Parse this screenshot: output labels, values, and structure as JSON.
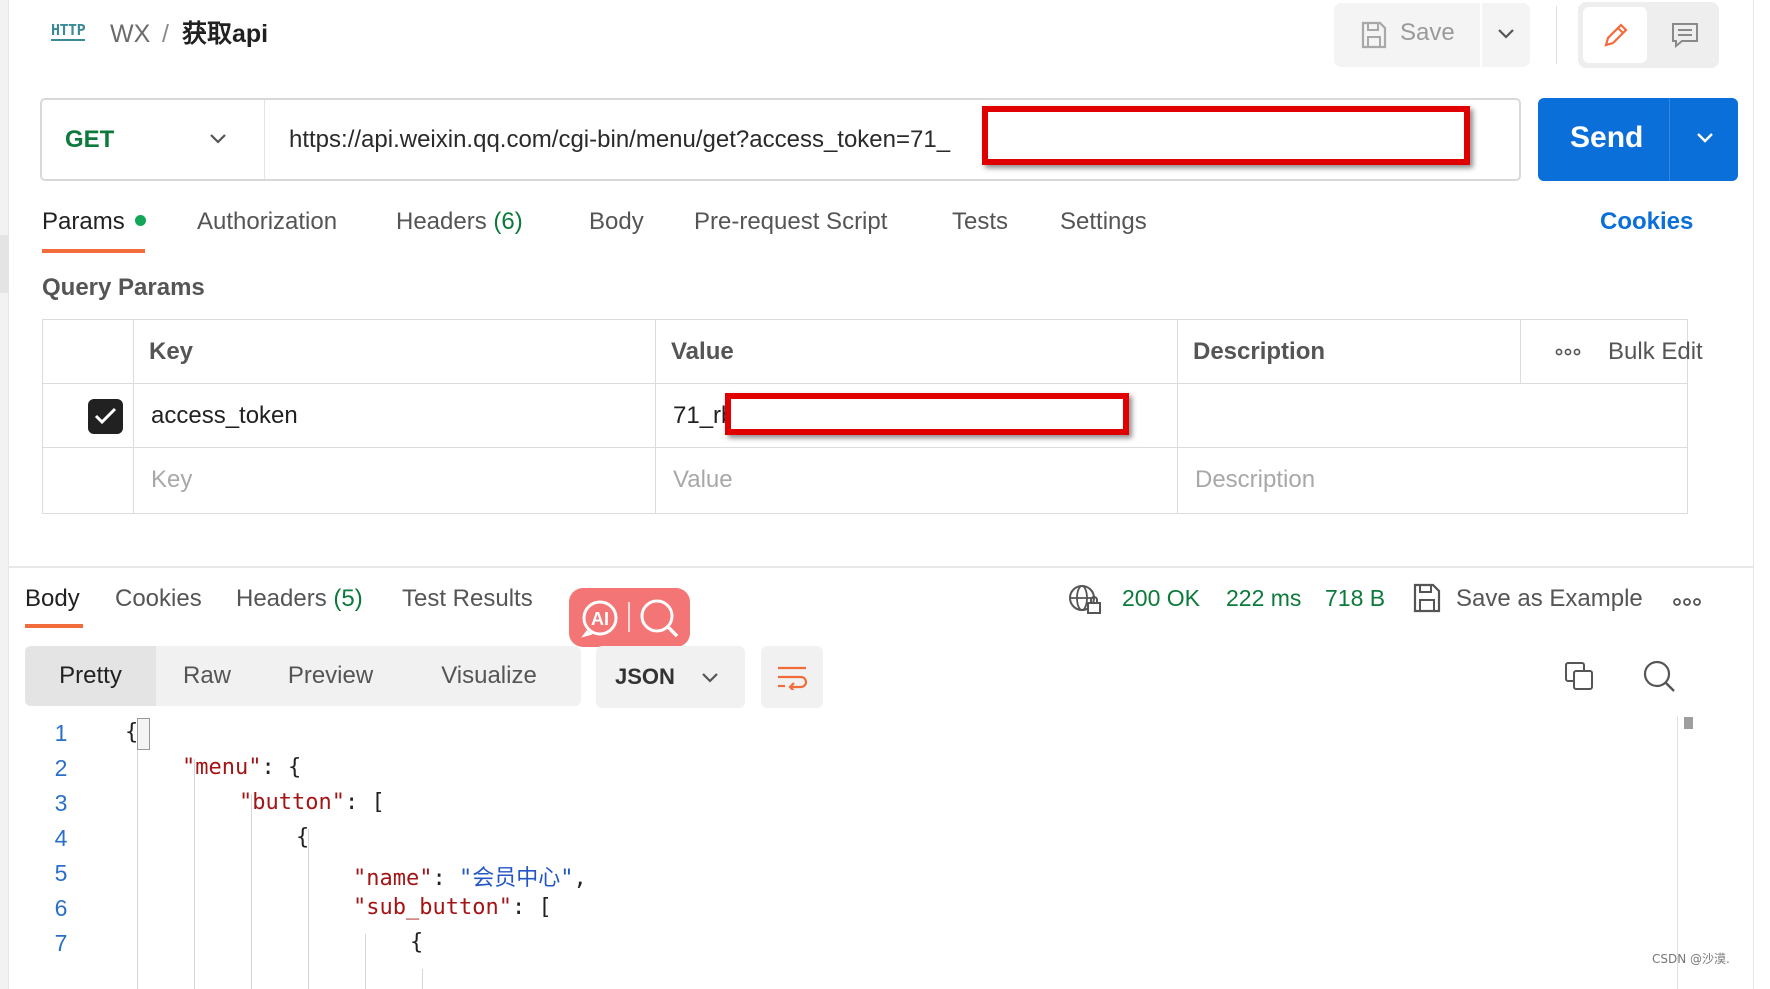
{
  "header": {
    "protocol_badge": "HTTP",
    "workspace": "WX",
    "separator": "/",
    "request_name": "获取api",
    "save_label": "Save"
  },
  "request": {
    "method": "GET",
    "url": "https://api.weixin.qq.com/cgi-bin/menu/get?access_token=71_",
    "send_label": "Send"
  },
  "request_tabs": [
    {
      "label": "Params",
      "dot": true
    },
    {
      "label": "Authorization"
    },
    {
      "label": "Headers",
      "count": "(6)"
    },
    {
      "label": "Body"
    },
    {
      "label": "Pre-request Script"
    },
    {
      "label": "Tests"
    },
    {
      "label": "Settings"
    }
  ],
  "cookies_link": "Cookies",
  "query_params": {
    "title": "Query Params",
    "headers": {
      "key": "Key",
      "value": "Value",
      "description": "Description",
      "bulk_edit": "Bulk Edit"
    },
    "rows": [
      {
        "checked": true,
        "key": "access_token",
        "value": "71_rb",
        "description": ""
      }
    ],
    "placeholder": {
      "key": "Key",
      "value": "Value",
      "description": "Description"
    }
  },
  "response": {
    "tabs": [
      {
        "label": "Body"
      },
      {
        "label": "Cookies"
      },
      {
        "label": "Headers",
        "count": "(5)"
      },
      {
        "label": "Test Results"
      }
    ],
    "status": "200 OK",
    "time": "222 ms",
    "size": "718 B",
    "save_example": "Save as Example",
    "views": [
      "Pretty",
      "Raw",
      "Preview",
      "Visualize"
    ],
    "format": "JSON",
    "ai_badge": "AI"
  },
  "code_lines": [
    {
      "n": "1",
      "indent": 0,
      "parts": [
        [
          "p",
          "{"
        ]
      ]
    },
    {
      "n": "2",
      "indent": 1,
      "parts": [
        [
          "k",
          "\"menu\""
        ],
        [
          "p",
          ": {"
        ]
      ]
    },
    {
      "n": "3",
      "indent": 2,
      "parts": [
        [
          "k",
          "\"button\""
        ],
        [
          "p",
          ": ["
        ]
      ]
    },
    {
      "n": "4",
      "indent": 3,
      "parts": [
        [
          "p",
          "{"
        ]
      ]
    },
    {
      "n": "5",
      "indent": 4,
      "parts": [
        [
          "k",
          "\"name\""
        ],
        [
          "p",
          ": "
        ],
        [
          "s",
          "\"会员中心\""
        ],
        [
          "p",
          ","
        ]
      ]
    },
    {
      "n": "6",
      "indent": 4,
      "parts": [
        [
          "k",
          "\"sub_button\""
        ],
        [
          "p",
          ": ["
        ]
      ]
    },
    {
      "n": "7",
      "indent": 5,
      "parts": [
        [
          "p",
          "{"
        ]
      ]
    }
  ],
  "watermark": "CSDN @沙漠.",
  "colors": {
    "accent_orange": "#f26b3a",
    "send_blue": "#0b6fd9",
    "get_green": "#0c7a3b",
    "redaction_red": "#e10000"
  },
  "icons": [
    "http-icon",
    "save-icon",
    "chevron-down-icon",
    "pencil-icon",
    "comment-icon",
    "check-icon",
    "more-horizontal-icon",
    "ai-icon",
    "search-icon",
    "globe-lock-icon",
    "save-example-icon",
    "wrap-lines-icon",
    "copy-icon"
  ]
}
